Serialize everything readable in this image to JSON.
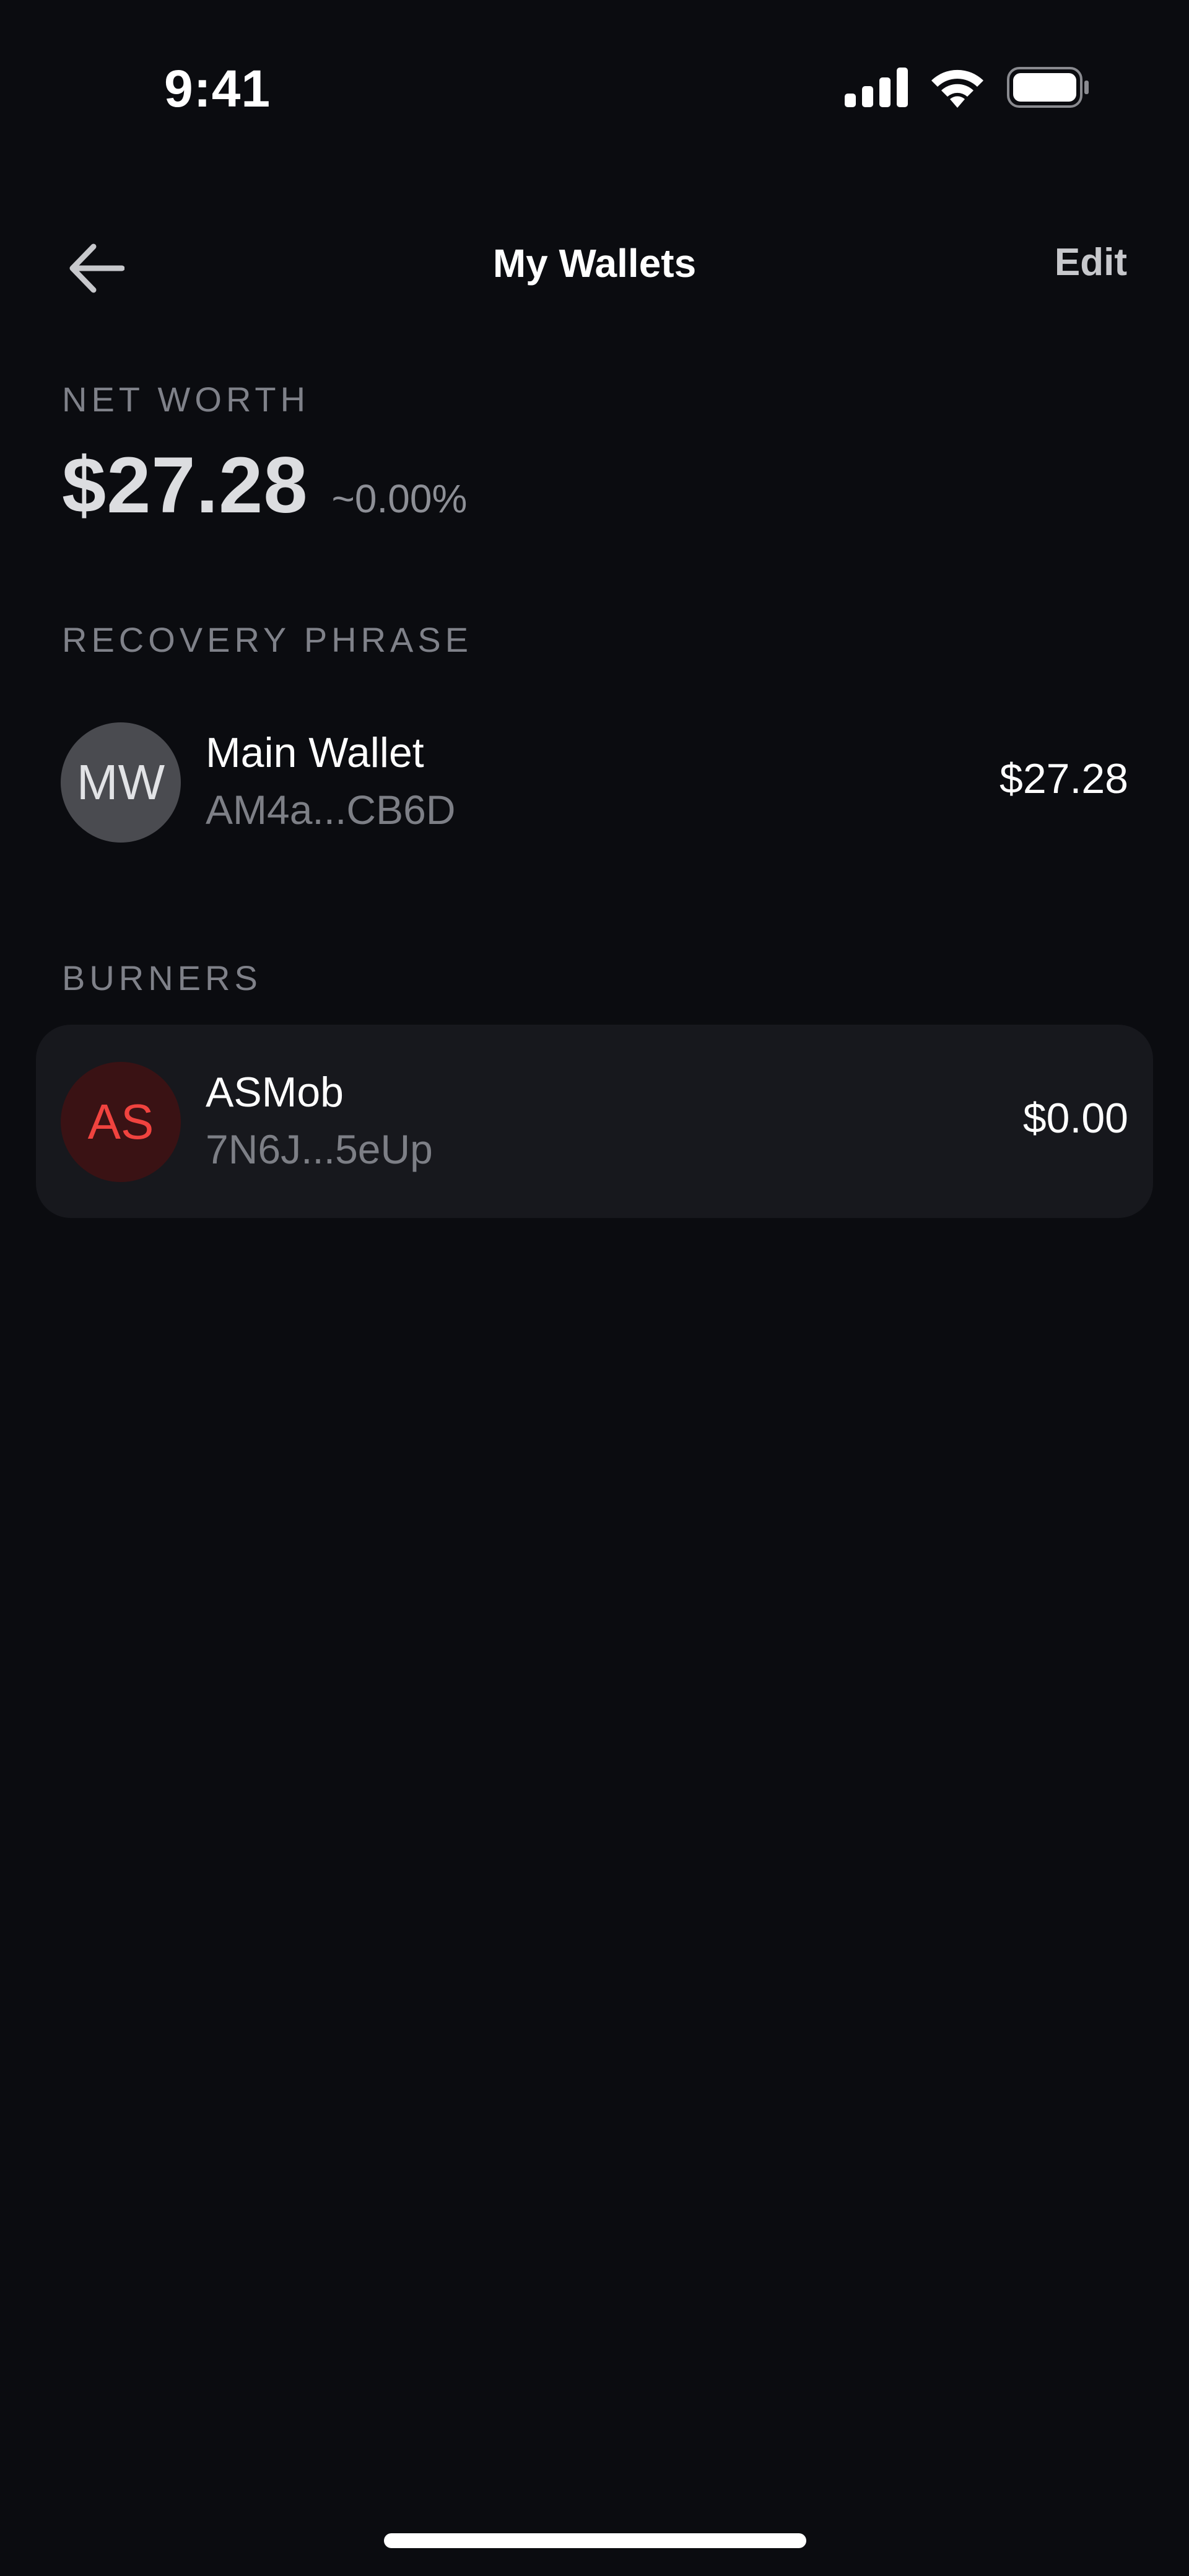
{
  "status_bar": {
    "time": "9:41",
    "icons": [
      "cellular-signal-icon",
      "wifi-icon",
      "battery-icon"
    ]
  },
  "header": {
    "title": "My Wallets",
    "edit_label": "Edit",
    "back_icon": "arrow-left-icon"
  },
  "net_worth": {
    "label": "NET WORTH",
    "value": "$27.28",
    "change": "~0.00%"
  },
  "recovery_phrase": {
    "label": "RECOVERY PHRASE",
    "wallets": [
      {
        "initials": "MW",
        "name": "Main Wallet",
        "address": "AM4a...CB6D",
        "balance": "$27.28",
        "avatar_bg": "#4a4b50",
        "avatar_fg": "#e2e3e6"
      }
    ]
  },
  "burners": {
    "label": "BURNERS",
    "wallets": [
      {
        "initials": "AS",
        "name": "ASMob",
        "address": "7N6J...5eUp",
        "balance": "$0.00",
        "avatar_bg": "#3a1214",
        "avatar_fg": "#f0433f"
      }
    ]
  },
  "colors": {
    "background": "#0b0c10",
    "card": "#17181d",
    "muted_text": "#7f8189",
    "primary_text": "#ffffff"
  }
}
